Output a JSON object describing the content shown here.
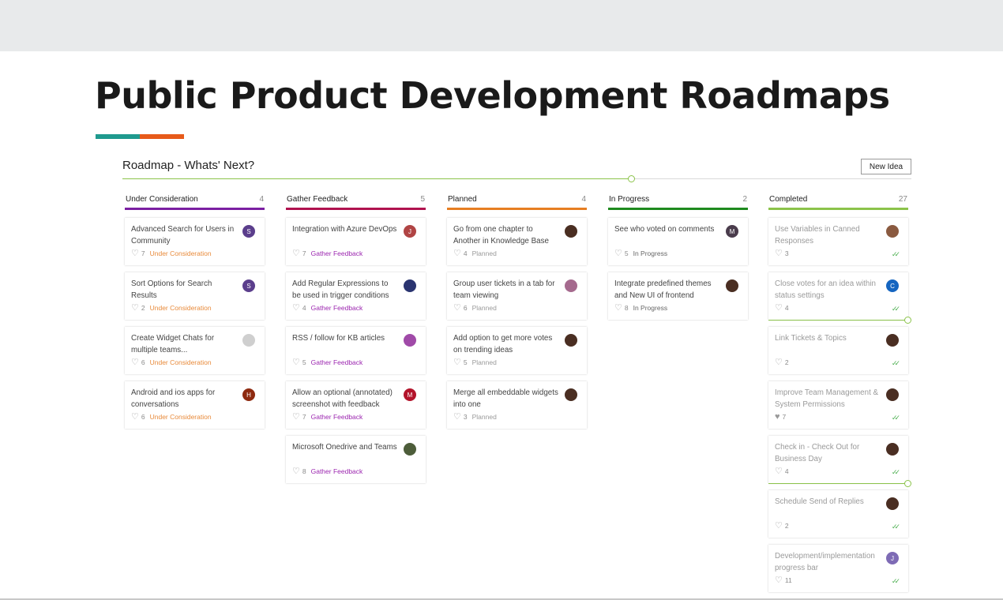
{
  "slide": {
    "title": "Public Product Development Roadmaps",
    "accent_colors": [
      "#1f9a8e",
      "#e75a1a"
    ]
  },
  "board": {
    "title": "Roadmap - Whats' Next?",
    "new_idea_label": "New Idea",
    "progress": 0.645
  },
  "columns": [
    {
      "id": "under-consideration",
      "name": "Under Consideration",
      "count": "4",
      "color": "#7b1fa2",
      "status_color": "#e88a3a",
      "cards": [
        {
          "title": "Advanced Search for Users in Community",
          "votes": "7",
          "status": "Under Consideration",
          "avatar": {
            "letter": "S",
            "color": "#5b3e8c"
          }
        },
        {
          "title": "Sort Options for Search Results",
          "votes": "2",
          "status": "Under Consideration",
          "avatar": {
            "letter": "S",
            "color": "#5b3e8c"
          }
        },
        {
          "title": "Create Widget Chats for multiple teams...",
          "votes": "6",
          "status": "Under Consideration",
          "avatar": {
            "letter": "",
            "color": "#cfcfcf"
          }
        },
        {
          "title": "Android and ios apps for conversations",
          "votes": "6",
          "status": "Under Consideration",
          "avatar": {
            "letter": "H",
            "color": "#8e2a10"
          }
        }
      ]
    },
    {
      "id": "gather-feedback",
      "name": "Gather Feedback",
      "count": "5",
      "color": "#b0124f",
      "status_color": "#9c27b0",
      "cards": [
        {
          "title": "Integration with Azure DevOps",
          "votes": "7",
          "status": "Gather Feedback",
          "avatar": {
            "letter": "J",
            "color": "#b04444"
          }
        },
        {
          "title": "Add Regular Expressions to be used in trigger conditions",
          "votes": "4",
          "status": "Gather Feedback",
          "avatar": {
            "letter": "",
            "color": "#2a3470"
          }
        },
        {
          "title": "RSS / follow for KB articles",
          "votes": "5",
          "status": "Gather Feedback",
          "avatar": {
            "letter": "",
            "color": "#a04aa8"
          }
        },
        {
          "title": "Allow an optional (annotated) screenshot with feedback",
          "votes": "7",
          "status": "Gather Feedback",
          "avatar": {
            "letter": "M",
            "color": "#b3142b"
          }
        },
        {
          "title": "Microsoft Onedrive and Teams",
          "votes": "8",
          "status": "Gather Feedback",
          "avatar": {
            "letter": "",
            "color": "#4d5d3a"
          }
        }
      ]
    },
    {
      "id": "planned",
      "name": "Planned",
      "count": "4",
      "color": "#e67e22",
      "status_color": "#9a9a9a",
      "cards": [
        {
          "title": "Go from one chapter to Another in Knowledge Base",
          "votes": "4",
          "status": "Planned",
          "avatar": {
            "letter": "",
            "color": "#4a2e22"
          }
        },
        {
          "title": "Group user tickets in a tab for team viewing",
          "votes": "6",
          "status": "Planned",
          "avatar": {
            "letter": "",
            "color": "#a56a8e"
          }
        },
        {
          "title": "Add option to get more votes on trending ideas",
          "votes": "5",
          "status": "Planned",
          "avatar": {
            "letter": "",
            "color": "#4a2e22"
          }
        },
        {
          "title": "Merge all embeddable widgets into one",
          "votes": "3",
          "status": "Planned",
          "avatar": {
            "letter": "",
            "color": "#4a2e22"
          }
        }
      ]
    },
    {
      "id": "in-progress",
      "name": "In Progress",
      "count": "2",
      "color": "#1e8a1e",
      "status_color": "#666666",
      "cards": [
        {
          "title": "See who voted on comments",
          "votes": "5",
          "status": "In Progress",
          "avatar": {
            "letter": "M",
            "color": "#4a3c4c"
          }
        },
        {
          "title": "Integrate predefined themes and New UI of frontend",
          "votes": "8",
          "status": "In Progress",
          "avatar": {
            "letter": "",
            "color": "#4a2e22"
          }
        }
      ]
    },
    {
      "id": "completed",
      "name": "Completed",
      "count": "27",
      "color": "#8bc34a",
      "status_color": "#9a9a9a",
      "cards": [
        {
          "title": "Use Variables in Canned Responses",
          "votes": "3",
          "status": "",
          "avatar": {
            "letter": "",
            "color": "#8a5a40"
          }
        },
        {
          "title": "Close votes for an idea within status settings",
          "votes": "4",
          "status": "",
          "avatar": {
            "letter": "C",
            "color": "#1565c0"
          }
        },
        {
          "title": "Link Tickets & Topics",
          "votes": "2",
          "status": "",
          "avatar": {
            "letter": "",
            "color": "#4a2e22"
          }
        },
        {
          "title": "Improve Team Management & System Permissions",
          "votes": "7",
          "status": "",
          "avatar": {
            "letter": "",
            "color": "#4a2e22"
          }
        },
        {
          "title": "Check in - Check Out for Business Day",
          "votes": "4",
          "status": "",
          "avatar": {
            "letter": "",
            "color": "#4a2e22"
          }
        },
        {
          "title": "Schedule Send of Replies",
          "votes": "2",
          "status": "",
          "avatar": {
            "letter": "",
            "color": "#4a2e22"
          }
        },
        {
          "title": "Development/implementation progress bar",
          "votes": "11",
          "status": "",
          "avatar": {
            "letter": "J",
            "color": "#7e6bb5"
          }
        }
      ]
    }
  ]
}
